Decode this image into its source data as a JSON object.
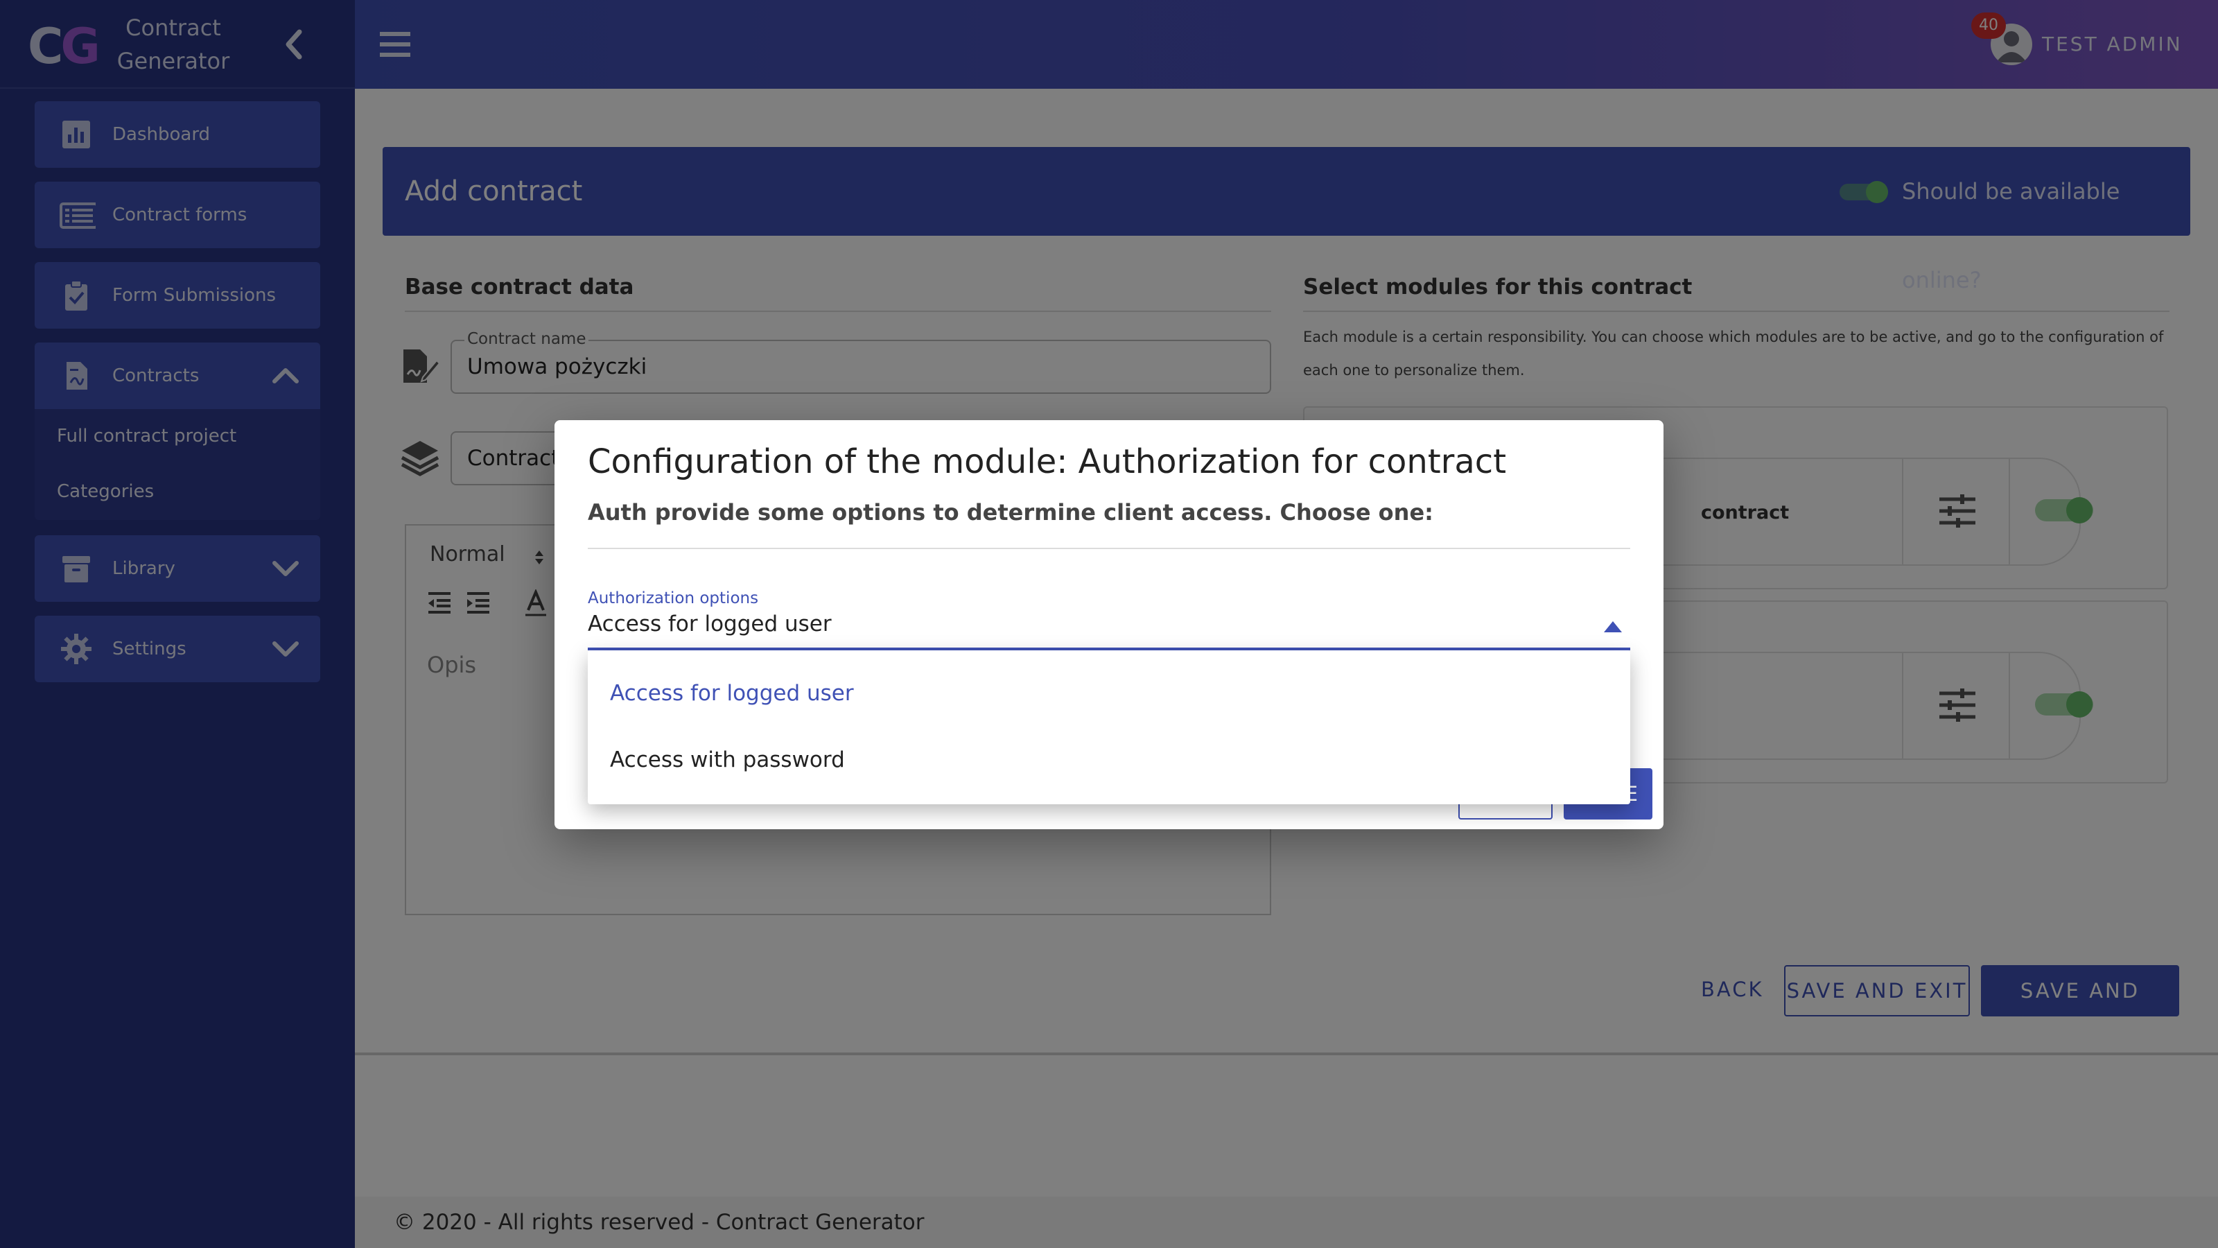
{
  "app": {
    "logo_c": "C",
    "logo_g": "G",
    "name_line1": "Contract",
    "name_line2": "Generator"
  },
  "sidebar": {
    "items": [
      {
        "label": "Dashboard",
        "icon": "chart-icon"
      },
      {
        "label": "Contract forms",
        "icon": "list-icon"
      },
      {
        "label": "Form Submissions",
        "icon": "clipboard-check-icon"
      },
      {
        "label": "Contracts",
        "icon": "document-icon",
        "expanded": true
      },
      {
        "label": "Library",
        "icon": "archive-icon",
        "expanded": false
      },
      {
        "label": "Settings",
        "icon": "gear-icon",
        "expanded": false
      }
    ],
    "contracts_sub": [
      {
        "label": "Full contract project"
      },
      {
        "label": "Categories"
      }
    ]
  },
  "header": {
    "notifications": "40",
    "user": "TEST ADMIN"
  },
  "page": {
    "title": "Add contract",
    "online_label": "Should be available online?",
    "online_enabled": true,
    "base_section": "Base contract data",
    "modules_section": "Select modules for this contract",
    "modules_desc": "Each module is a certain responsibility. You can choose which modules are to be active, and go to the configuration of each one to personalize them.",
    "contract_name_label": "Contract name",
    "contract_name_value": "Umowa pożyczki",
    "category_value": "Contract",
    "editor_format": "Normal",
    "editor_placeholder": "Opis",
    "module1_label": "contract",
    "module1_enabled": true,
    "module2_enabled": true,
    "buttons": {
      "back": "BACK",
      "save_exit": "SAVE AND EXIT",
      "save_build": "SAVE AND BUILD"
    }
  },
  "dialog": {
    "title": "Configuration of the module: Authorization for contract",
    "subtitle": "Auth provide some options to determine client access. Choose one:",
    "select_label": "Authorization options",
    "select_value": "Access for logged user",
    "options": [
      {
        "label": "Access for logged user",
        "selected": true
      },
      {
        "label": "Access with password",
        "selected": false
      }
    ],
    "ok_partial": "E"
  },
  "footer": {
    "text": "© 2020 - All rights reserved - Contract Generator"
  },
  "colors": {
    "primary": "#3f51b5",
    "sidebar": "#293583",
    "toggle_on": "#66bb6a",
    "badge": "#d32f2f"
  }
}
